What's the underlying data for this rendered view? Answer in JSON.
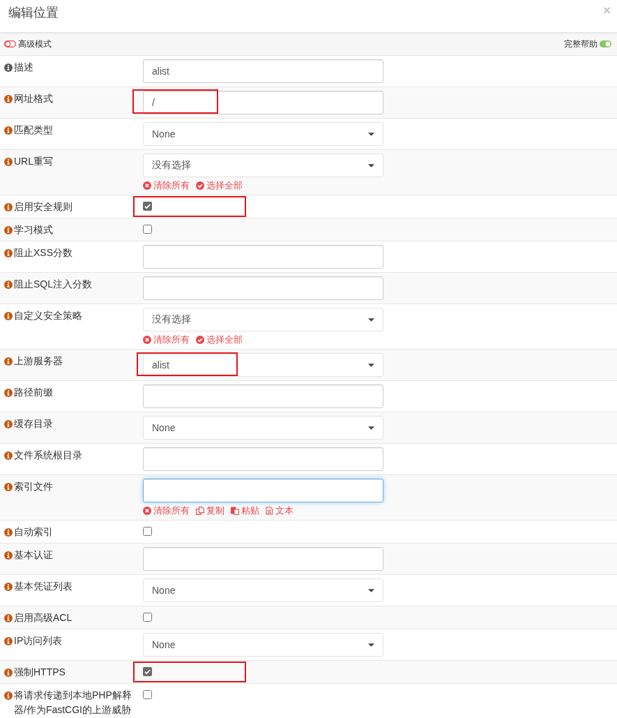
{
  "dialog": {
    "title": "编辑位置",
    "close": "×"
  },
  "toolbar": {
    "advanced_mode": {
      "label": "高级模式",
      "on": false
    },
    "full_help": {
      "label": "完整帮助",
      "on": true
    }
  },
  "rows": [
    {
      "label": "描述",
      "help": false,
      "kind": "text",
      "value": "alist",
      "focused": false,
      "highlighted": false
    },
    {
      "label": "网址格式",
      "help": true,
      "kind": "text",
      "value": "/",
      "focused": false,
      "highlighted": true
    },
    {
      "label": "匹配类型",
      "help": true,
      "kind": "select",
      "value": "None",
      "focused": false,
      "highlighted": false
    },
    {
      "label": "URL重写",
      "help": true,
      "kind": "select",
      "value": "没有选择",
      "focused": false,
      "highlighted": false,
      "actions": [
        {
          "kind": "clear",
          "label": "清除所有"
        },
        {
          "kind": "select_all",
          "label": "选择全部"
        }
      ]
    },
    {
      "label": "启用安全规则",
      "help": true,
      "kind": "checkbox",
      "checked": true,
      "focused": false,
      "highlighted": true
    },
    {
      "label": "学习模式",
      "help": true,
      "kind": "checkbox",
      "checked": false,
      "focused": false,
      "highlighted": false
    },
    {
      "label": "阻止XSS分数",
      "help": true,
      "kind": "text",
      "focused": false,
      "highlighted": false
    },
    {
      "label": "阻止SQL注入分数",
      "help": true,
      "kind": "text",
      "focused": false,
      "highlighted": false
    },
    {
      "label": "自定义安全策略",
      "help": true,
      "kind": "select",
      "value": "没有选择",
      "focused": false,
      "highlighted": false,
      "actions": [
        {
          "kind": "clear",
          "label": "清除所有"
        },
        {
          "kind": "select_all",
          "label": "选择全部"
        }
      ]
    },
    {
      "label": "上游服务器",
      "help": true,
      "kind": "select",
      "value": "alist",
      "focused": false,
      "highlighted": true
    },
    {
      "label": "路径前缀",
      "help": true,
      "kind": "text",
      "focused": false,
      "highlighted": false
    },
    {
      "label": "缓存目录",
      "help": true,
      "kind": "select",
      "value": "None",
      "focused": false,
      "highlighted": false
    },
    {
      "label": "文件系统根目录",
      "help": true,
      "kind": "text",
      "focused": false,
      "highlighted": false
    },
    {
      "label": "索引文件",
      "help": true,
      "kind": "text",
      "focused": true,
      "highlighted": false,
      "actions": [
        {
          "kind": "clear",
          "label": "清除所有"
        },
        {
          "kind": "copy",
          "label": "复制"
        },
        {
          "kind": "paste",
          "label": "粘贴"
        },
        {
          "kind": "text",
          "label": "文本"
        }
      ]
    },
    {
      "label": "自动索引",
      "help": true,
      "kind": "checkbox",
      "checked": false,
      "focused": false,
      "highlighted": false
    },
    {
      "label": "基本认证",
      "help": true,
      "kind": "text",
      "focused": false,
      "highlighted": false
    },
    {
      "label": "基本凭证列表",
      "help": true,
      "kind": "select",
      "value": "None",
      "focused": false,
      "highlighted": false
    },
    {
      "label": "启用高级ACL",
      "help": true,
      "kind": "checkbox",
      "checked": false,
      "focused": false,
      "highlighted": false
    },
    {
      "label": "IP访问列表",
      "help": true,
      "kind": "select",
      "value": "None",
      "focused": false,
      "highlighted": false
    },
    {
      "label": "强制HTTPS",
      "help": true,
      "kind": "checkbox",
      "checked": true,
      "focused": false,
      "highlighted": true
    },
    {
      "label": "将请求传递到本地PHP解释器/作为FastCGI的上游威胁",
      "help": true,
      "kind": "checkbox",
      "checked": false,
      "focused": false,
      "highlighted": false
    }
  ]
}
